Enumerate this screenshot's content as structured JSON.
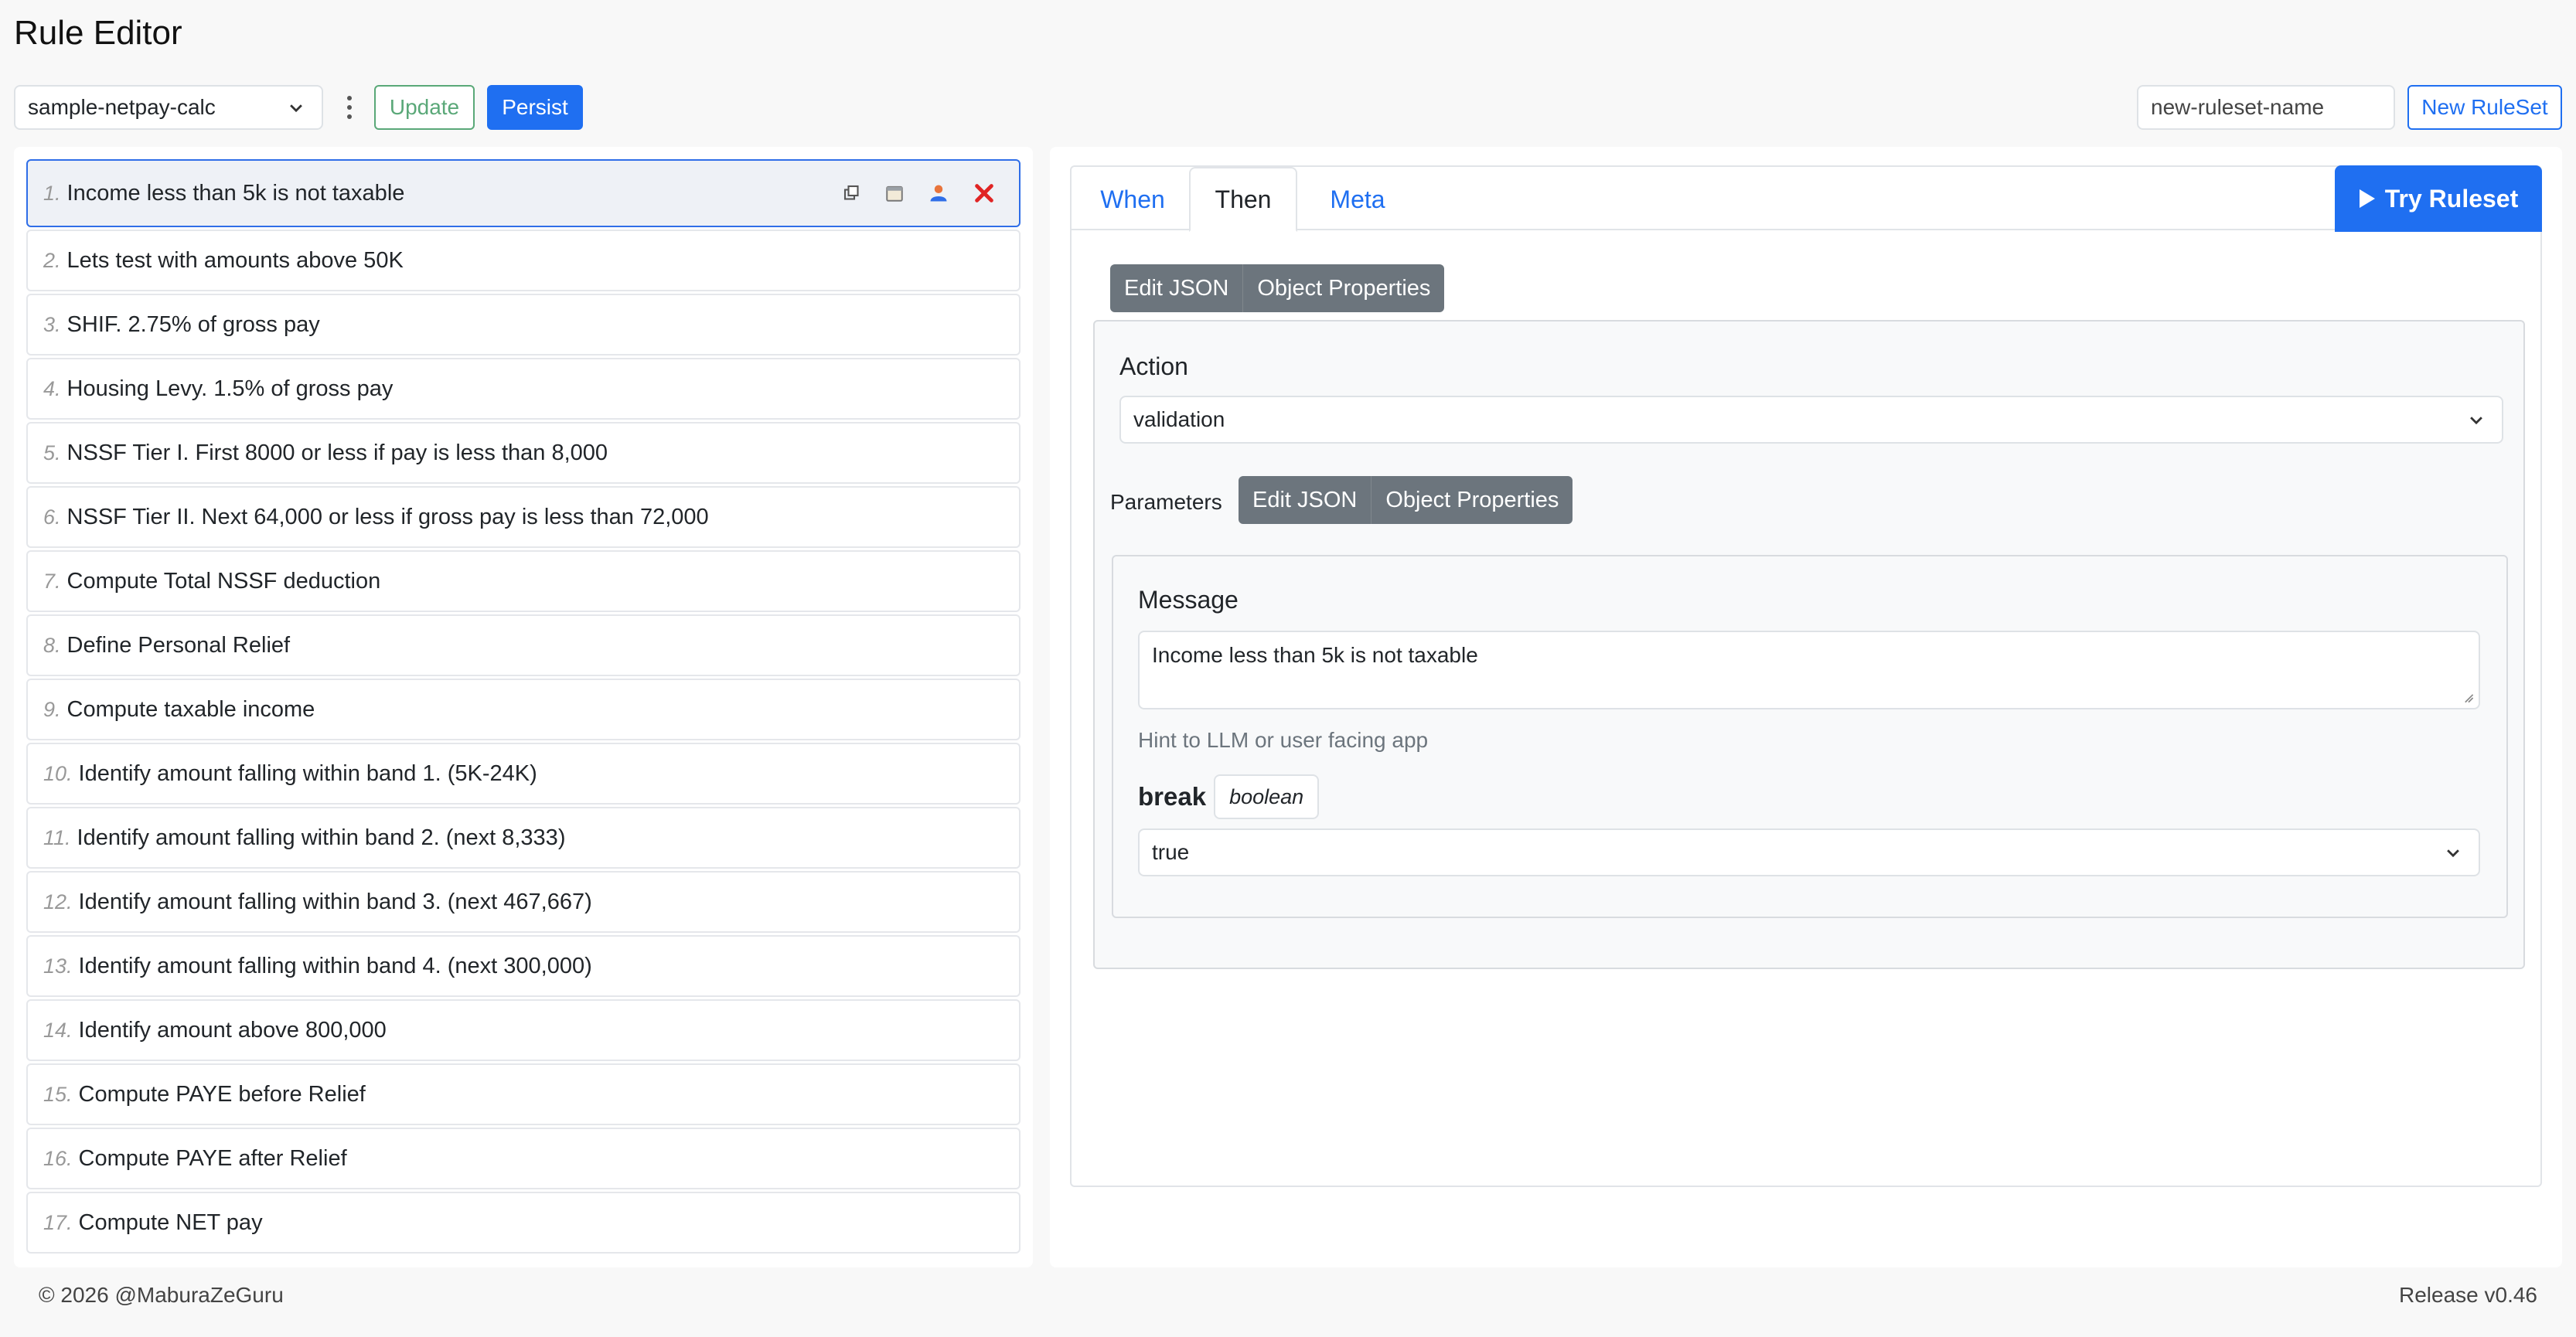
{
  "header": {
    "title": "Rule Editor"
  },
  "toolbar": {
    "ruleset_selected": "sample-netpay-calc",
    "update_label": "Update",
    "persist_label": "Persist",
    "new_name_placeholder": "new-ruleset-name",
    "new_ruleset_label": "New RuleSet"
  },
  "rules": [
    {
      "num": "1.",
      "title": "Income less than 5k is not taxable"
    },
    {
      "num": "2.",
      "title": "Lets test with amounts above 50K"
    },
    {
      "num": "3.",
      "title": "SHIF. 2.75% of gross pay"
    },
    {
      "num": "4.",
      "title": "Housing Levy. 1.5% of gross pay"
    },
    {
      "num": "5.",
      "title": "NSSF Tier I. First 8000 or less if pay is less than 8,000"
    },
    {
      "num": "6.",
      "title": "NSSF Tier II. Next 64,000 or less if gross pay is less than 72,000"
    },
    {
      "num": "7.",
      "title": "Compute Total NSSF deduction"
    },
    {
      "num": "8.",
      "title": "Define Personal Relief"
    },
    {
      "num": "9.",
      "title": "Compute taxable income"
    },
    {
      "num": "10.",
      "title": "Identify amount falling within band 1. (5K-24K)"
    },
    {
      "num": "11.",
      "title": "Identify amount falling within band 2. (next 8,333)"
    },
    {
      "num": "12.",
      "title": "Identify amount falling within band 3. (next 467,667)"
    },
    {
      "num": "13.",
      "title": "Identify amount falling within band 4. (next 300,000)"
    },
    {
      "num": "14.",
      "title": "Identify amount above 800,000"
    },
    {
      "num": "15.",
      "title": "Compute PAYE before Relief"
    },
    {
      "num": "16.",
      "title": "Compute PAYE after Relief"
    },
    {
      "num": "17.",
      "title": "Compute NET pay"
    }
  ],
  "tabs": {
    "when": "When",
    "then": "Then",
    "meta": "Meta",
    "try": "Try Ruleset"
  },
  "then_panel": {
    "edit_json": "Edit JSON",
    "object_properties": "Object Properties",
    "action_label": "Action",
    "action_value": "validation",
    "parameters_label": "Parameters",
    "params_edit_json": "Edit JSON",
    "params_object_properties": "Object Properties",
    "message_label": "Message",
    "message_value": "Income less than 5k is not taxable",
    "hint": "Hint to LLM or user facing app",
    "break_label": "break",
    "break_type": "boolean",
    "break_value": "true"
  },
  "footer": {
    "copyright": "© 2026 @MaburaZeGuru",
    "release": "Release v0.46"
  },
  "colors": {
    "accent": "#1f6ff1",
    "update_green": "#5aa878",
    "delete_red": "#e02424",
    "segment_gray": "#6c757d"
  }
}
